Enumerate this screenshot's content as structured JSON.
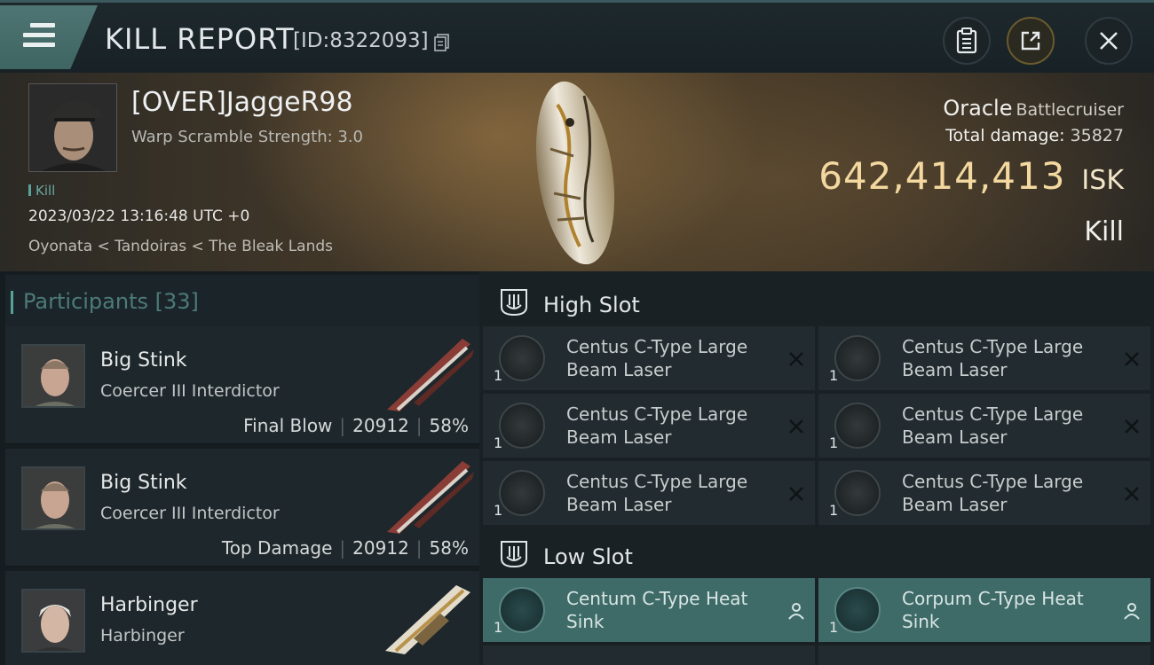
{
  "header": {
    "title": "KILL REPORT",
    "report_id": "[ID:8322093]",
    "icons": [
      "menu-icon",
      "copy-icon",
      "clipboard-icon",
      "share-icon",
      "close-icon"
    ]
  },
  "victim": {
    "name": "[OVER]JaggeR98",
    "warp_scramble": "Warp Scramble Strength: 3.0",
    "tag": "Kill",
    "timestamp": "2023/03/22 13:16:48 UTC +0",
    "location": "Oyonata < Tandoiras < The Bleak Lands",
    "ship_name": "Oracle",
    "ship_class": "Battlecruiser",
    "total_damage_label": "Total damage:",
    "total_damage_value": "35827",
    "isk_value": "642,414,413",
    "isk_unit": "ISK",
    "type": "Kill"
  },
  "participants": {
    "label": "Participants",
    "count": "[33]",
    "rows": [
      {
        "name": "Big Stink",
        "ship": "Coercer III Interdictor",
        "badge": "Final Blow",
        "damage": "20912",
        "percent": "58%"
      },
      {
        "name": "Big Stink",
        "ship": "Coercer III Interdictor",
        "badge": "Top Damage",
        "damage": "20912",
        "percent": "58%"
      },
      {
        "name": "Harbinger",
        "ship": "Harbinger",
        "badge": "",
        "damage": "",
        "percent": ""
      }
    ]
  },
  "fitting": {
    "high_slot_label": "High Slot",
    "low_slot_label": "Low Slot",
    "high_slot": [
      {
        "name": "Centus C-Type Large Beam Laser",
        "qty": "1",
        "status": "destroyed"
      },
      {
        "name": "Centus C-Type Large Beam Laser",
        "qty": "1",
        "status": "destroyed"
      },
      {
        "name": "Centus C-Type Large Beam Laser",
        "qty": "1",
        "status": "destroyed"
      },
      {
        "name": "Centus C-Type Large Beam Laser",
        "qty": "1",
        "status": "destroyed"
      },
      {
        "name": "Centus C-Type Large Beam Laser",
        "qty": "1",
        "status": "destroyed"
      },
      {
        "name": "Centus C-Type Large Beam Laser",
        "qty": "1",
        "status": "destroyed"
      }
    ],
    "low_slot": [
      {
        "name": "Centum C-Type Heat Sink",
        "qty": "1",
        "status": "dropped"
      },
      {
        "name": "Corpum C-Type Heat Sink",
        "qty": "1",
        "status": "dropped"
      }
    ]
  },
  "colors": {
    "accent": "#5aa19a",
    "isk_gold": "#f3d8a0",
    "low_slot_bg": "#3e6b68"
  }
}
